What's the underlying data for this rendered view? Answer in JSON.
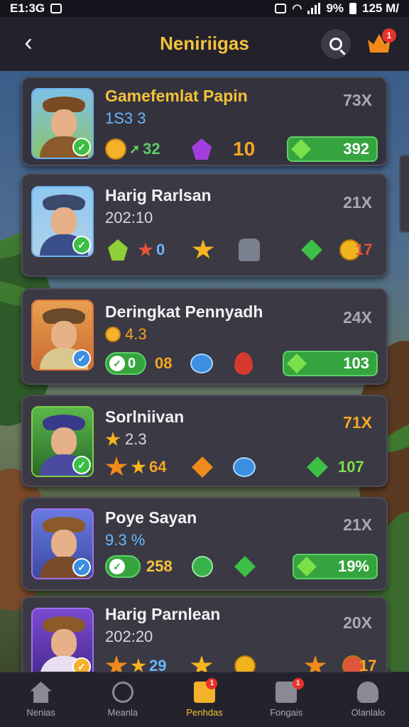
{
  "status_bar": {
    "time": "E1:3G",
    "battery": "9%",
    "clock": "125 M/"
  },
  "header": {
    "title": "Neniriigas",
    "crown_badge": "1"
  },
  "cards": [
    {
      "name": "Gamefemlat Papin",
      "sub": "1S3 3",
      "multiplier": "73X",
      "items": [
        "32",
        "10"
      ],
      "bar_value": "392"
    },
    {
      "name": "Harig Rarlsan",
      "sub": "202:10",
      "multiplier": "21X",
      "items": [
        "0",
        "17"
      ]
    },
    {
      "name": "Deringkat Pennyadh",
      "sub": "4.3",
      "multiplier": "24X",
      "items": [
        "08"
      ],
      "pill_value": "0",
      "bar_value": "103"
    },
    {
      "name": "Sorlniivan",
      "sub": "2.3",
      "multiplier": "71X",
      "items": [
        "64"
      ],
      "bar_value": "107"
    },
    {
      "name": "Poye Sayan",
      "sub": "9.3 %",
      "multiplier": "21X",
      "items": [
        "258"
      ],
      "bar_value": "19%"
    },
    {
      "name": "Harig Parnlean",
      "sub": "202:20",
      "multiplier": "20X",
      "items": [
        "29",
        "17"
      ]
    }
  ],
  "bottom_nav": [
    {
      "label": "Nenias"
    },
    {
      "label": "Meanla"
    },
    {
      "label": "Penhdas",
      "badge": "1"
    },
    {
      "label": "Fongais",
      "badge": "1"
    },
    {
      "label": "Olanlalo"
    }
  ]
}
